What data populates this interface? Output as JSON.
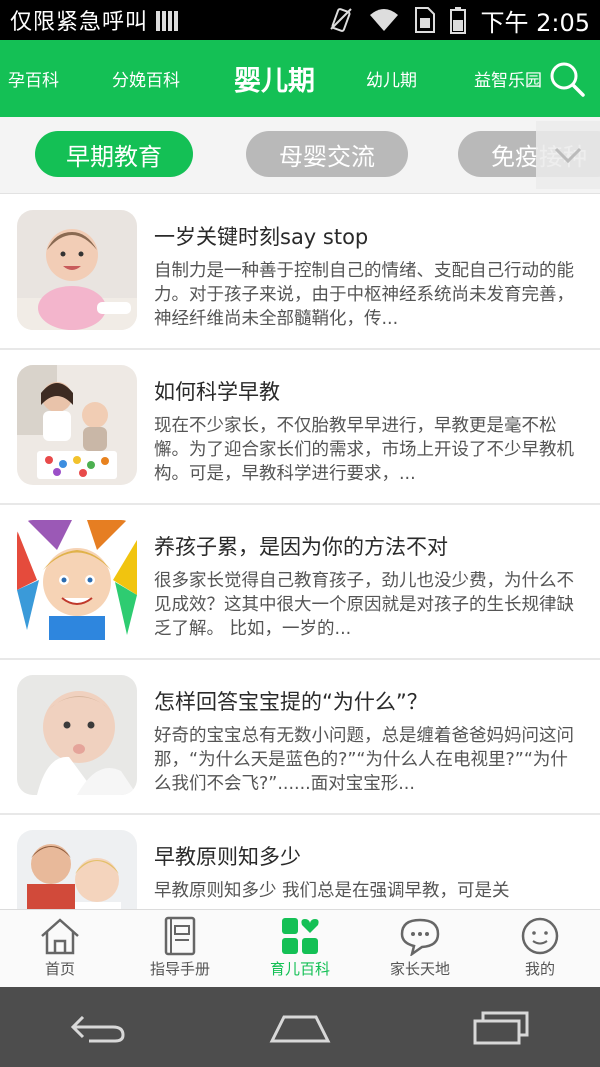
{
  "status_bar": {
    "carrier": "仅限紧急呼叫",
    "time": "下午 2:05"
  },
  "header": {
    "categories": [
      "孕百科",
      "分娩百科",
      "婴儿期",
      "幼儿期",
      "益智乐园"
    ],
    "active_index": 2,
    "accent_color": "#14c055"
  },
  "subtabs": {
    "items": [
      "早期教育",
      "母婴交流",
      "免疫接种"
    ],
    "active_index": 0
  },
  "articles": [
    {
      "title": "一岁关键时刻say stop",
      "summary": "  自制力是一种善于控制自己的情绪、支配自己行动的能力。对于孩子来说，由于中枢神经系统尚未发育完善，神经纤维尚未全部髓鞘化，传..."
    },
    {
      "title": "如何科学早教",
      "summary": "  现在不少家长，不仅胎教早早进行，早教更是毫不松懈。为了迎合家长们的需求，市场上开设了不少早教机构。可是，早教科学进行要求，..."
    },
    {
      "title": "养孩子累，是因为你的方法不对",
      "summary": "  很多家长觉得自己教育孩子，劲儿也没少费，为什么不见成效？这其中很大一个原因就是对孩子的生长规律缺乏了解。    比如，一岁的..."
    },
    {
      "title": "怎样回答宝宝提的“为什么”？",
      "summary": "     好奇的宝宝总有无数小问题，总是缠着爸爸妈妈问这问那，“为什么天是蓝色的?”“为什么人在电视里?”“为什么我们不会飞?”......面对宝宝形..."
    },
    {
      "title": "早教原则知多少",
      "summary": "  早教原则知多少  我们总是在强调早教，可是关"
    }
  ],
  "bottom_nav": {
    "items": [
      {
        "label": "首页",
        "icon": "home-icon"
      },
      {
        "label": "指导手册",
        "icon": "book-icon"
      },
      {
        "label": "育儿百科",
        "icon": "grid-heart-icon"
      },
      {
        "label": "家长天地",
        "icon": "chat-icon"
      },
      {
        "label": "我的",
        "icon": "smile-icon"
      }
    ],
    "active_index": 2
  }
}
